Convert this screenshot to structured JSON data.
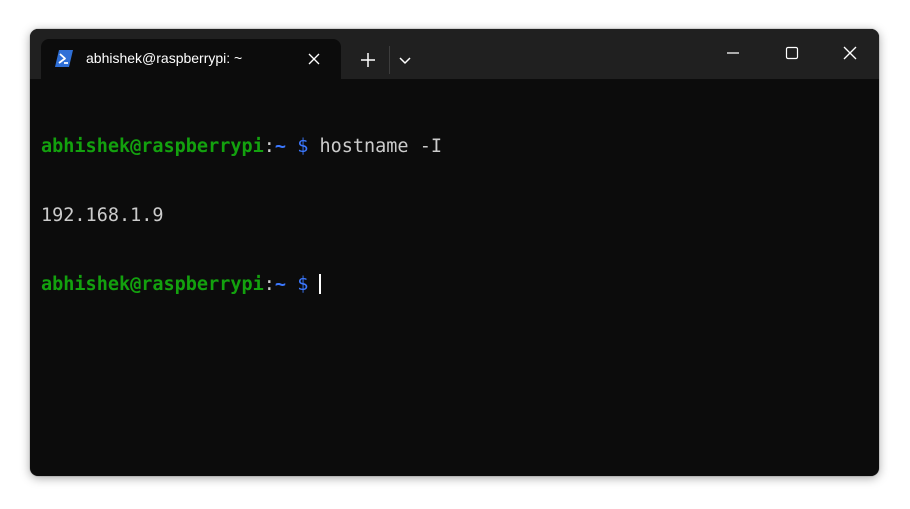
{
  "titlebar": {
    "tab": {
      "title": "abhishek@raspberrypi: ~",
      "icon": "powershell-icon"
    },
    "new_tab_icon": "plus-icon",
    "dropdown_icon": "chevron-down-icon",
    "window_controls": [
      "minimize-icon",
      "maximize-icon",
      "close-icon"
    ]
  },
  "terminal": {
    "lines": [
      {
        "user_host": "abhishek@raspberrypi",
        "separator": ":",
        "path": "~",
        "prompt": "$",
        "command": "hostname -I"
      },
      {
        "output": "192.168.1.9"
      },
      {
        "user_host": "abhishek@raspberrypi",
        "separator": ":",
        "path": "~",
        "prompt": "$",
        "command": ""
      }
    ]
  },
  "colors": {
    "background": "#0c0c0c",
    "titlebar": "#202020",
    "user_host": "#13a10e",
    "path_prompt": "#3b78ff",
    "text": "#cccccc"
  }
}
